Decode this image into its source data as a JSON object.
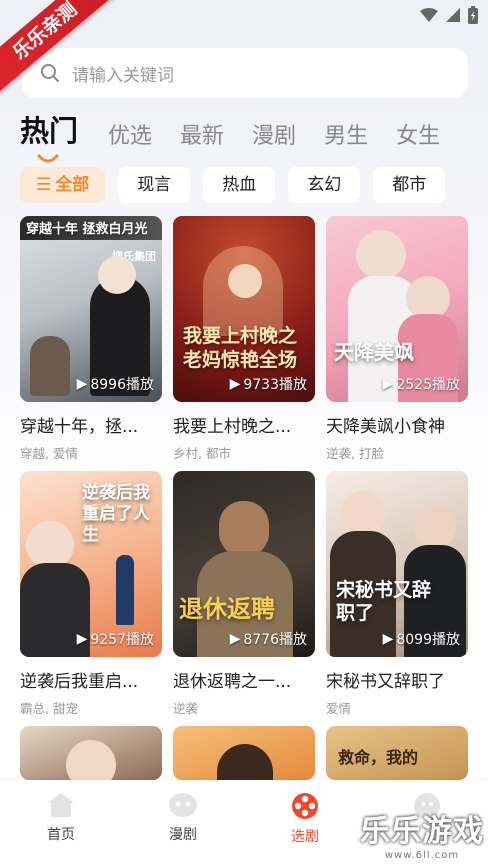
{
  "watermark_corner": "乐乐亲测",
  "search": {
    "placeholder": "请输入关键词"
  },
  "tabs": [
    "热门",
    "优选",
    "最新",
    "漫剧",
    "男生",
    "女生"
  ],
  "chips": [
    {
      "label": "全部",
      "active": true
    },
    {
      "label": "现言"
    },
    {
      "label": "热血"
    },
    {
      "label": "玄幻"
    },
    {
      "label": "都市"
    }
  ],
  "cards": [
    {
      "poster_text": "穿越十年 拯救白月光",
      "poster_sub": "柳氏集团",
      "plays": "8996播放",
      "title": "穿越十年，拯...",
      "tags": "穿越, 爱情"
    },
    {
      "poster_text": "我要上村晚之老妈惊艳全场",
      "plays": "9733播放",
      "title": "我要上村晚之...",
      "tags": "乡村, 都市"
    },
    {
      "poster_text": "天降美飒",
      "plays": "2525播放",
      "title": "天降美飒小食神",
      "tags": "逆袭, 打脸"
    },
    {
      "poster_text": "逆袭后我重启了人生",
      "plays": "9257播放",
      "title": "逆袭后我重启...",
      "tags": "霸总, 甜宠"
    },
    {
      "poster_text": "退休返聘",
      "plays": "8776播放",
      "title": "退休返聘之一...",
      "tags": "逆袭"
    },
    {
      "poster_text": "宋秘书又辞职了",
      "plays": "8099播放",
      "title": "宋秘书又辞职了",
      "tags": "爱情"
    },
    {
      "poster_text": ""
    },
    {
      "poster_text": ""
    },
    {
      "poster_text": "救命，我的"
    }
  ],
  "nav": [
    {
      "label": "首页",
      "icon": "home-icon"
    },
    {
      "label": "漫剧",
      "icon": "comic-icon"
    },
    {
      "label": "选剧",
      "icon": "film-reel-icon",
      "active": true
    },
    {
      "label": "",
      "icon": "profile-icon"
    }
  ],
  "watermark": {
    "big": "乐乐游戏",
    "small": "www.6ll.com"
  }
}
